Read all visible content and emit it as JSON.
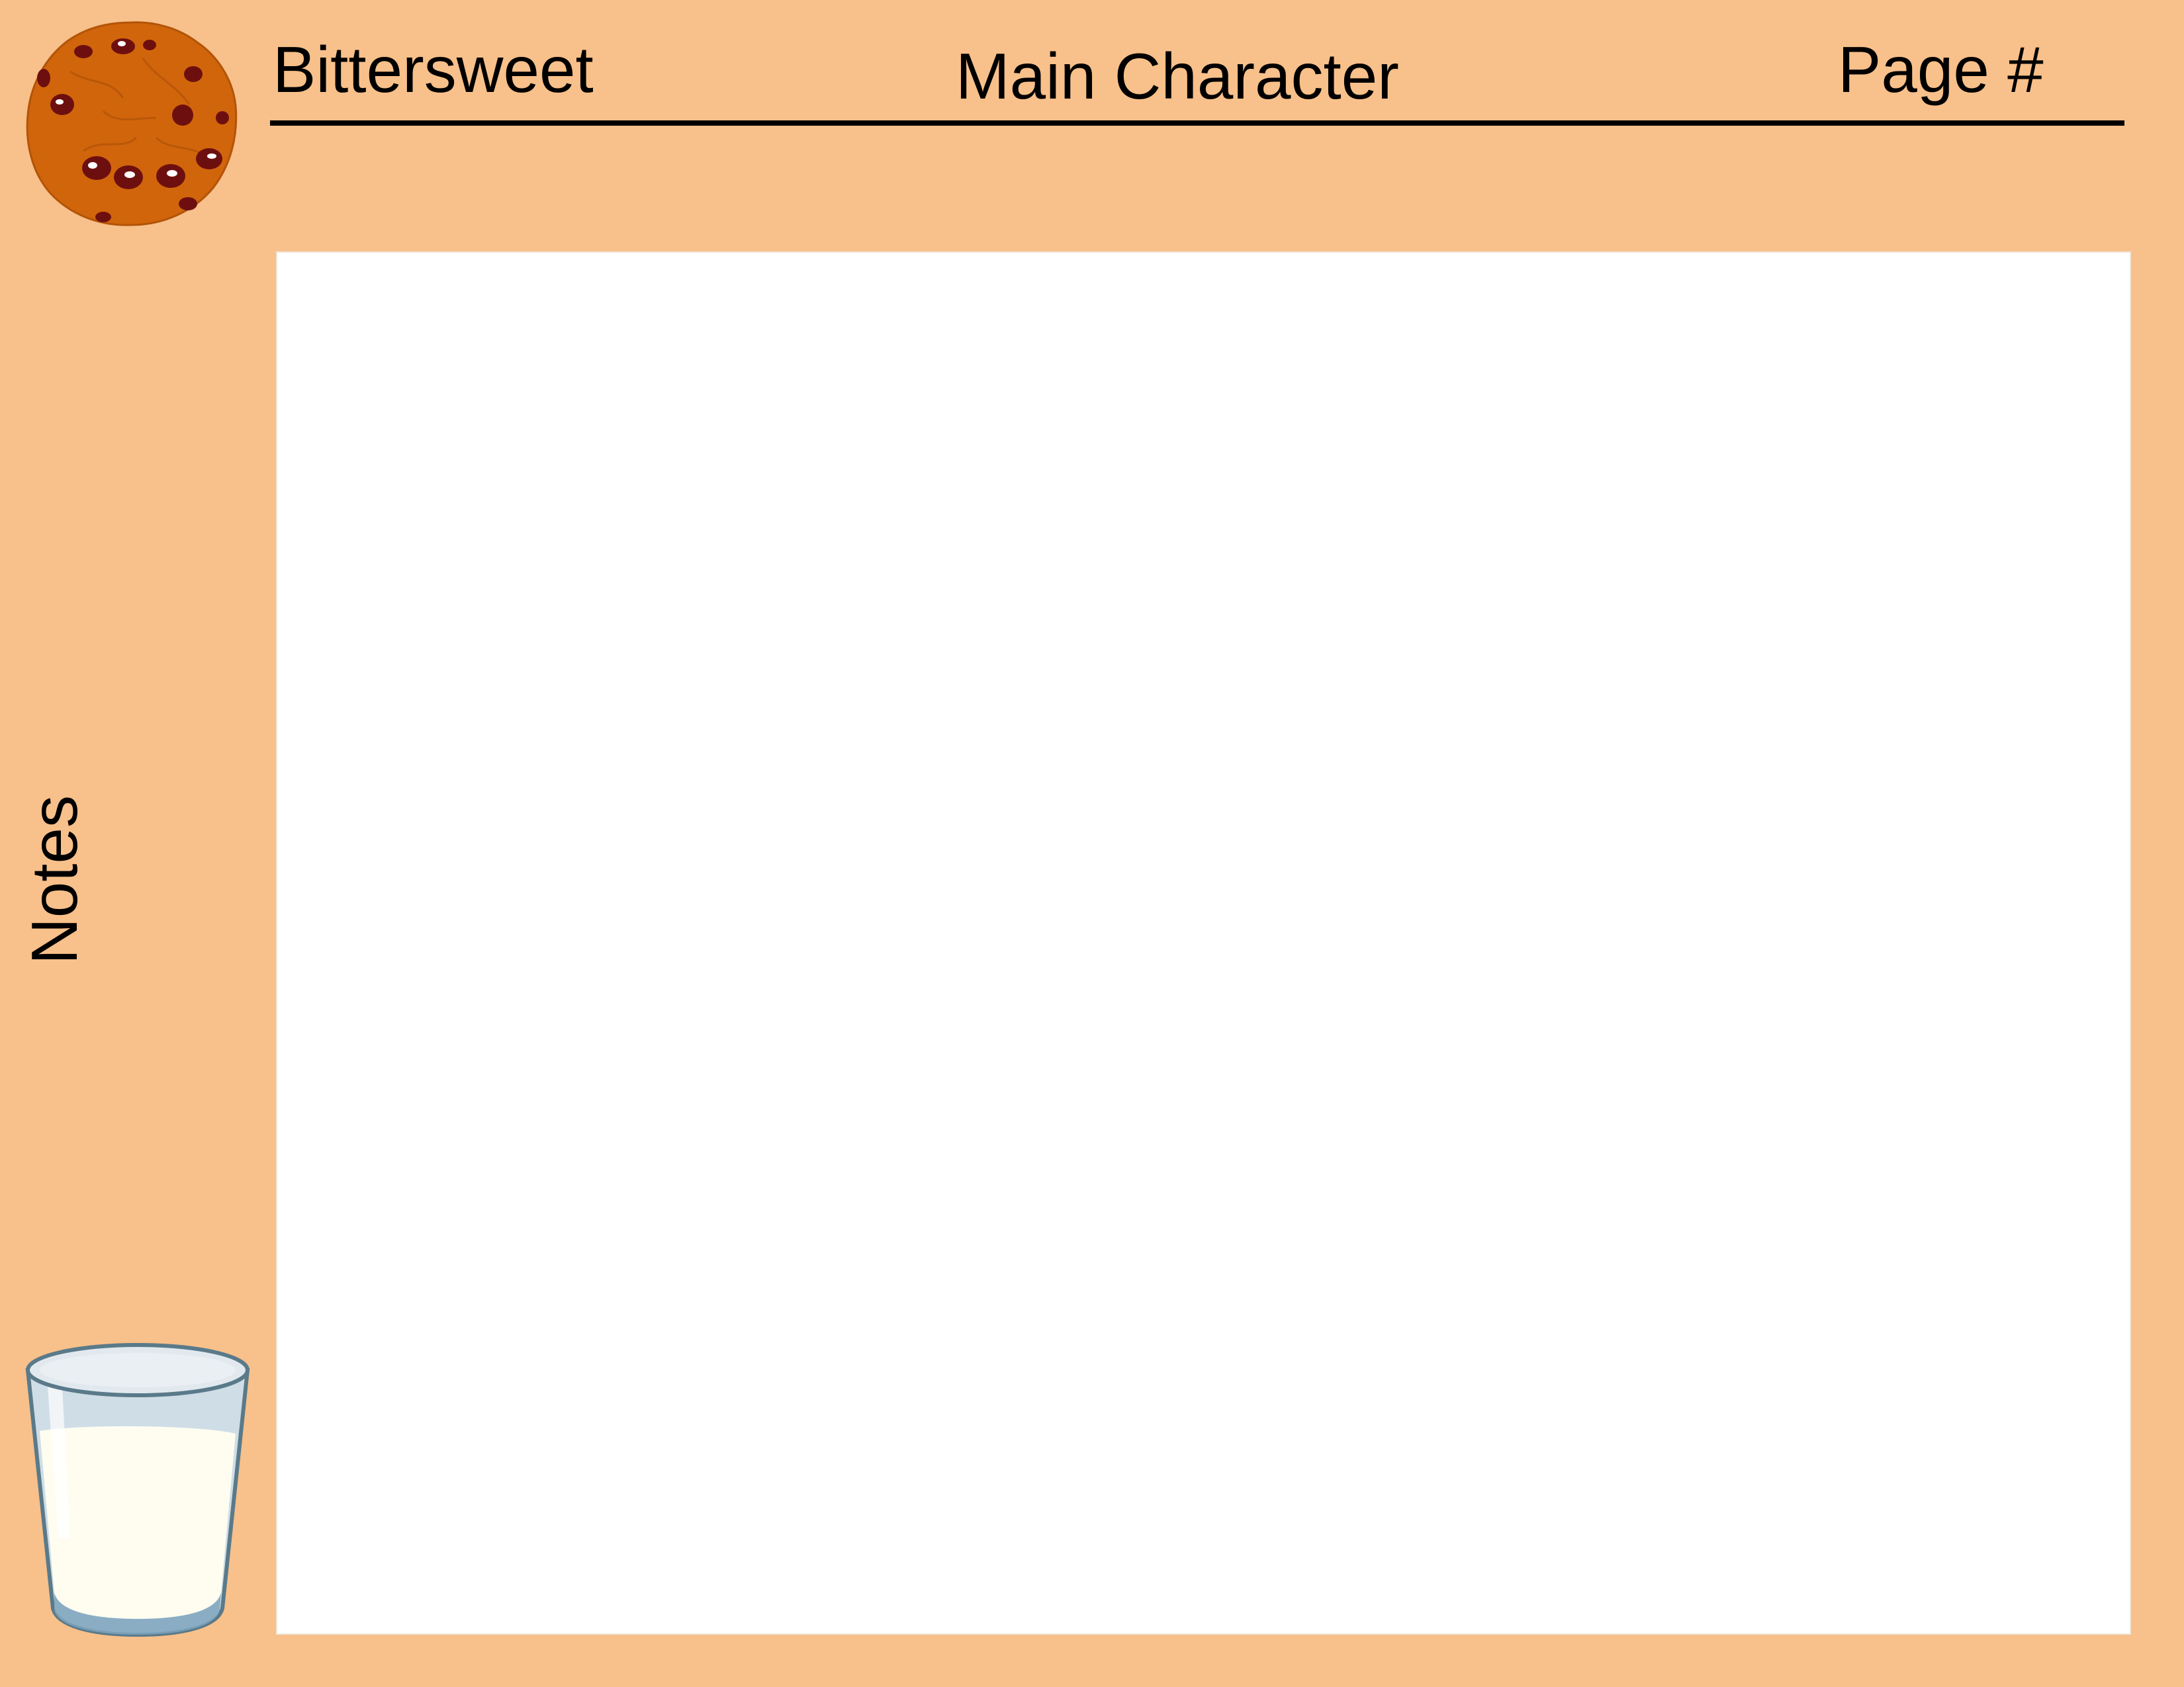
{
  "header": {
    "title": "Bittersweet",
    "subtitle": "Main Character",
    "page_label": "Page #"
  },
  "sidebar": {
    "notes_label": "Notes"
  },
  "icons": {
    "cookie": "chocolate-chip-cookie-icon",
    "milk": "glass-of-milk-icon"
  },
  "colors": {
    "background": "#f8c08a",
    "notes_area": "#ffffff",
    "rule": "#000000"
  }
}
